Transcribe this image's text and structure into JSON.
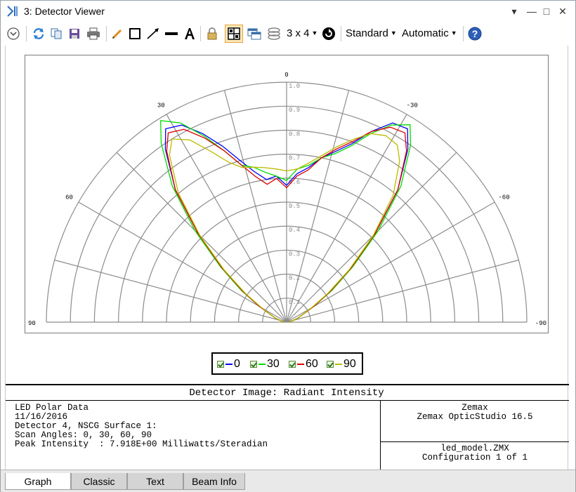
{
  "window": {
    "title": "3: Detector Viewer",
    "buttons": {
      "menu": "▾",
      "minimize": "—",
      "maximize": "□",
      "close": "✕"
    }
  },
  "toolbar": {
    "layout_label": "3 x 4",
    "standard_label": "Standard",
    "automatic_label": "Automatic",
    "icons": [
      "expand-icon",
      "refresh-icon",
      "copy-icon",
      "save-icon",
      "print-icon",
      "pencil-icon",
      "rectangle-icon",
      "arrow-icon",
      "line-icon",
      "text-icon",
      "lock-icon",
      "grid-icon",
      "window-icon",
      "layers-icon",
      "layout-dropdown",
      "cycle-icon",
      "help-icon"
    ]
  },
  "chart_data": {
    "type": "line",
    "projection": "polar",
    "theta_range": [
      90,
      -90
    ],
    "radial_range": [
      0,
      1.0
    ],
    "radial_ticks": [
      "0.1",
      "0.2",
      "0.3",
      "0.4",
      "0.5",
      "0.6",
      "0.7",
      "0.8",
      "0.9",
      "1.0"
    ],
    "angle_labels": [
      {
        "angle": 0,
        "label": "0"
      },
      {
        "angle": 30,
        "label": "30"
      },
      {
        "angle": -30,
        "label": "-30"
      },
      {
        "angle": 60,
        "label": "60"
      },
      {
        "angle": -60,
        "label": "-60"
      },
      {
        "angle": 90,
        "label": "90"
      },
      {
        "angle": -90,
        "label": "-90"
      }
    ],
    "angle_grid_step": 15,
    "grid": true,
    "legend_position": "bottom-center",
    "series": [
      {
        "name": "0",
        "color": "#0000ff",
        "points": [
          [
            90,
            0.01
          ],
          [
            80,
            0.02
          ],
          [
            70,
            0.05
          ],
          [
            60,
            0.13
          ],
          [
            55,
            0.22
          ],
          [
            50,
            0.35
          ],
          [
            45,
            0.52
          ],
          [
            40,
            0.72
          ],
          [
            35,
            0.88
          ],
          [
            32,
            0.95
          ],
          [
            28,
            0.93
          ],
          [
            24,
            0.86
          ],
          [
            20,
            0.78
          ],
          [
            16,
            0.7
          ],
          [
            12,
            0.64
          ],
          [
            8,
            0.6
          ],
          [
            4,
            0.61
          ],
          [
            0,
            0.57
          ],
          [
            -4,
            0.62
          ],
          [
            -8,
            0.65
          ],
          [
            -12,
            0.7
          ],
          [
            -16,
            0.74
          ],
          [
            -20,
            0.79
          ],
          [
            -24,
            0.87
          ],
          [
            -28,
            0.94
          ],
          [
            -32,
            0.95
          ],
          [
            -35,
            0.88
          ],
          [
            -40,
            0.72
          ],
          [
            -45,
            0.52
          ],
          [
            -50,
            0.35
          ],
          [
            -55,
            0.22
          ],
          [
            -60,
            0.13
          ],
          [
            -70,
            0.05
          ],
          [
            -80,
            0.02
          ],
          [
            -90,
            0.01
          ]
        ]
      },
      {
        "name": "30",
        "color": "#00dd00",
        "points": [
          [
            90,
            0.01
          ],
          [
            80,
            0.02
          ],
          [
            70,
            0.05
          ],
          [
            60,
            0.13
          ],
          [
            55,
            0.23
          ],
          [
            50,
            0.36
          ],
          [
            45,
            0.54
          ],
          [
            40,
            0.74
          ],
          [
            35,
            0.91
          ],
          [
            32,
            0.99
          ],
          [
            28,
            0.94
          ],
          [
            24,
            0.85
          ],
          [
            20,
            0.76
          ],
          [
            16,
            0.68
          ],
          [
            12,
            0.66
          ],
          [
            8,
            0.63
          ],
          [
            4,
            0.61
          ],
          [
            0,
            0.59
          ],
          [
            -4,
            0.64
          ],
          [
            -8,
            0.66
          ],
          [
            -12,
            0.7
          ],
          [
            -16,
            0.73
          ],
          [
            -20,
            0.78
          ],
          [
            -24,
            0.86
          ],
          [
            -28,
            0.93
          ],
          [
            -32,
            0.97
          ],
          [
            -35,
            0.9
          ],
          [
            -40,
            0.74
          ],
          [
            -45,
            0.54
          ],
          [
            -50,
            0.36
          ],
          [
            -55,
            0.23
          ],
          [
            -60,
            0.13
          ],
          [
            -70,
            0.05
          ],
          [
            -80,
            0.02
          ],
          [
            -90,
            0.01
          ]
        ]
      },
      {
        "name": "60",
        "color": "#dd0000",
        "points": [
          [
            90,
            0.01
          ],
          [
            80,
            0.02
          ],
          [
            70,
            0.05
          ],
          [
            60,
            0.13
          ],
          [
            55,
            0.22
          ],
          [
            50,
            0.35
          ],
          [
            45,
            0.52
          ],
          [
            40,
            0.72
          ],
          [
            35,
            0.87
          ],
          [
            32,
            0.93
          ],
          [
            28,
            0.91
          ],
          [
            24,
            0.84
          ],
          [
            20,
            0.76
          ],
          [
            16,
            0.68
          ],
          [
            12,
            0.62
          ],
          [
            8,
            0.58
          ],
          [
            4,
            0.6
          ],
          [
            0,
            0.56
          ],
          [
            -4,
            0.61
          ],
          [
            -8,
            0.64
          ],
          [
            -12,
            0.7
          ],
          [
            -16,
            0.75
          ],
          [
            -20,
            0.8
          ],
          [
            -24,
            0.87
          ],
          [
            -28,
            0.92
          ],
          [
            -32,
            0.93
          ],
          [
            -35,
            0.87
          ],
          [
            -40,
            0.72
          ],
          [
            -45,
            0.52
          ],
          [
            -50,
            0.35
          ],
          [
            -55,
            0.22
          ],
          [
            -60,
            0.13
          ],
          [
            -70,
            0.05
          ],
          [
            -80,
            0.02
          ],
          [
            -90,
            0.01
          ]
        ]
      },
      {
        "name": "90",
        "color": "#bbbb00",
        "points": [
          [
            90,
            0.01
          ],
          [
            80,
            0.02
          ],
          [
            70,
            0.05
          ],
          [
            60,
            0.12
          ],
          [
            55,
            0.21
          ],
          [
            50,
            0.34
          ],
          [
            45,
            0.51
          ],
          [
            40,
            0.7
          ],
          [
            35,
            0.85
          ],
          [
            32,
            0.9
          ],
          [
            28,
            0.86
          ],
          [
            24,
            0.78
          ],
          [
            20,
            0.71
          ],
          [
            16,
            0.67
          ],
          [
            12,
            0.66
          ],
          [
            8,
            0.65
          ],
          [
            4,
            0.64
          ],
          [
            0,
            0.63
          ],
          [
            -4,
            0.64
          ],
          [
            -8,
            0.67
          ],
          [
            -12,
            0.71
          ],
          [
            -16,
            0.76
          ],
          [
            -20,
            0.81
          ],
          [
            -24,
            0.86
          ],
          [
            -28,
            0.88
          ],
          [
            -32,
            0.87
          ],
          [
            -35,
            0.82
          ],
          [
            -40,
            0.69
          ],
          [
            -45,
            0.51
          ],
          [
            -50,
            0.34
          ],
          [
            -55,
            0.21
          ],
          [
            -60,
            0.12
          ],
          [
            -70,
            0.05
          ],
          [
            -80,
            0.02
          ],
          [
            -90,
            0.01
          ]
        ]
      }
    ]
  },
  "legend": {
    "items": [
      {
        "label": "0",
        "color": "#0000ff"
      },
      {
        "label": "30",
        "color": "#00dd00"
      },
      {
        "label": "60",
        "color": "#dd0000"
      },
      {
        "label": "90",
        "color": "#bbbb00"
      }
    ]
  },
  "info": {
    "title": "Detector Image: Radiant Intensity",
    "left_text": "LED Polar Data\n11/16/2016\nDetector 4, NSCG Surface 1:\nScan Angles: 0, 30, 60, 90\nPeak Intensity  : 7.918E+00 Milliwatts/Steradian",
    "right_top": "Zemax\nZemax OpticStudio 16.5",
    "right_bottom": "led_model.ZMX\nConfiguration 1 of 1"
  },
  "tabs": [
    {
      "label": "Graph",
      "active": true
    },
    {
      "label": "Classic",
      "active": false
    },
    {
      "label": "Text",
      "active": false
    },
    {
      "label": "Beam Info",
      "active": false
    }
  ]
}
